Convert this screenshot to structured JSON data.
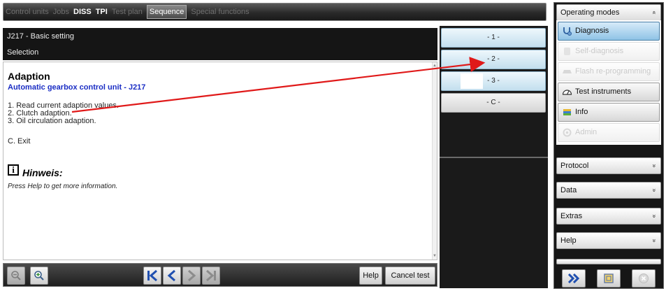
{
  "tabs": [
    {
      "label": "Control units",
      "style": "dim"
    },
    {
      "label": "Jobs",
      "style": "dim"
    },
    {
      "label": "DISS",
      "style": "bright"
    },
    {
      "label": "TPI",
      "style": "bright"
    },
    {
      "label": "Test plan",
      "style": "dim"
    },
    {
      "label": "Sequence",
      "style": "active"
    },
    {
      "label": "Special functions",
      "style": "dim"
    }
  ],
  "header": {
    "title": "J217 - Basic setting",
    "subtitle": "Selection"
  },
  "content": {
    "title": "Adaption",
    "subtitle": "Automatic gearbox control unit - J217",
    "options": [
      "1. Read current adaption values.",
      "2. Clutch adaption.",
      "3. Oil circulation adaption."
    ],
    "exit": "C. Exit",
    "hint_icon": "i",
    "hint_title": "Hinweis:",
    "hint_text": "Press Help to get more information."
  },
  "selection_buttons": [
    "- 1 -",
    "- 2 -",
    "- 3 -",
    "- C -"
  ],
  "toolbar": {
    "help_label": "Help",
    "cancel_label": "Cancel test",
    "icons": [
      "zoom-out-icon",
      "zoom-in-icon",
      "first-page-icon",
      "previous-page-icon",
      "next-page-icon",
      "last-page-icon"
    ]
  },
  "right_panel": {
    "operating_modes_label": "Operating modes",
    "modes": [
      {
        "label": "Diagnosis",
        "state": "active",
        "icon": "stethoscope-icon"
      },
      {
        "label": "Self-diagnosis",
        "state": "disabled",
        "icon": "car-door-icon"
      },
      {
        "label": "Flash re-programming",
        "state": "disabled",
        "icon": "car-icon"
      },
      {
        "label": "Test instruments",
        "state": "normal",
        "icon": "gauge-icon"
      },
      {
        "label": "Info",
        "state": "normal",
        "icon": "info-book-icon"
      },
      {
        "label": "Admin",
        "state": "disabled",
        "icon": "admin-gear-icon"
      }
    ],
    "sections": [
      "Protocol",
      "Data",
      "Extras",
      "Help"
    ],
    "expand_glyph": "»",
    "collapse_glyph": "«"
  },
  "colors": {
    "accent_blue": "#1a2dc4",
    "annotation_arrow": "#e01919"
  }
}
